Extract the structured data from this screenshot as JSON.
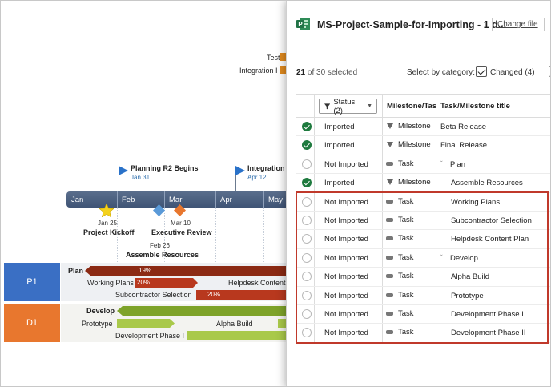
{
  "background": {
    "top_labels": [
      "Test",
      "Integration I"
    ],
    "flags": [
      {
        "title": "Planning R2 Begins",
        "date": "Jan 31"
      },
      {
        "title": "Integration",
        "date": "Apr 12"
      }
    ],
    "months": [
      "Jan",
      "Feb",
      "Mar",
      "Apr",
      "May"
    ],
    "milestones": [
      {
        "title": "Project Kickoff",
        "date": "Jan 25"
      },
      {
        "title": "Executive Review",
        "date": "Mar 10"
      },
      {
        "title": "Assemble Resources",
        "date": "Feb 26"
      }
    ],
    "swimlanes": [
      {
        "label": "P1",
        "color": "#3a6fc4"
      },
      {
        "label": "D1",
        "color": "#e8772e"
      }
    ],
    "tasks": {
      "plan": {
        "label": "Plan",
        "pct": "19%"
      },
      "working_plans": {
        "label": "Working Plans",
        "pct": "20%"
      },
      "helpdesk": {
        "label": "Helpdesk Content"
      },
      "subcontractor": {
        "label": "Subcontractor Selection",
        "pct": "20%"
      },
      "develop": {
        "label": "Develop"
      },
      "prototype": {
        "label": "Prototype"
      },
      "alpha": {
        "label": "Alpha Build"
      },
      "dev_phase": {
        "label": "Development Phase I"
      }
    }
  },
  "dialog": {
    "title": "MS-Project-Sample-for-Importing - 1 d...",
    "change_file": "Change file",
    "selected_count": "21",
    "selected_suffix": " of 30 selected",
    "category_label": "Select by category:",
    "changed_label": "Changed (4)",
    "columns": {
      "status_filter": "Status (2)",
      "type": "Milestone/Tas",
      "title": "Task/Milestone title"
    },
    "rows": [
      {
        "checked": true,
        "status": "Imported",
        "type": "Milestone",
        "title": "Beta Release",
        "indent": 0,
        "expand": false
      },
      {
        "checked": true,
        "status": "Imported",
        "type": "Milestone",
        "title": "Final Release",
        "indent": 0,
        "expand": false
      },
      {
        "checked": false,
        "status": "Not Imported",
        "type": "Task",
        "title": "Plan",
        "indent": 1,
        "expand": true
      },
      {
        "checked": true,
        "status": "Imported",
        "type": "Milestone",
        "title": "Assemble Resources",
        "indent": 2,
        "expand": false
      },
      {
        "checked": false,
        "status": "Not Imported",
        "type": "Task",
        "title": "Working Plans",
        "indent": 2,
        "expand": false
      },
      {
        "checked": false,
        "status": "Not Imported",
        "type": "Task",
        "title": "Subcontractor Selection",
        "indent": 2,
        "expand": false
      },
      {
        "checked": false,
        "status": "Not Imported",
        "type": "Task",
        "title": "Helpdesk Content Plan",
        "indent": 2,
        "expand": false
      },
      {
        "checked": false,
        "status": "Not Imported",
        "type": "Task",
        "title": "Develop",
        "indent": 1,
        "expand": true
      },
      {
        "checked": false,
        "status": "Not Imported",
        "type": "Task",
        "title": "Alpha Build",
        "indent": 2,
        "expand": false
      },
      {
        "checked": false,
        "status": "Not Imported",
        "type": "Task",
        "title": "Prototype",
        "indent": 2,
        "expand": false
      },
      {
        "checked": false,
        "status": "Not Imported",
        "type": "Task",
        "title": "Development Phase I",
        "indent": 2,
        "expand": false
      },
      {
        "checked": false,
        "status": "Not Imported",
        "type": "Task",
        "title": "Development Phase II",
        "indent": 2,
        "expand": false
      }
    ],
    "colors": {
      "checked_green": "#1e7a3e",
      "highlight_red": "#c0392b",
      "app_icon_green": "#217346"
    }
  }
}
